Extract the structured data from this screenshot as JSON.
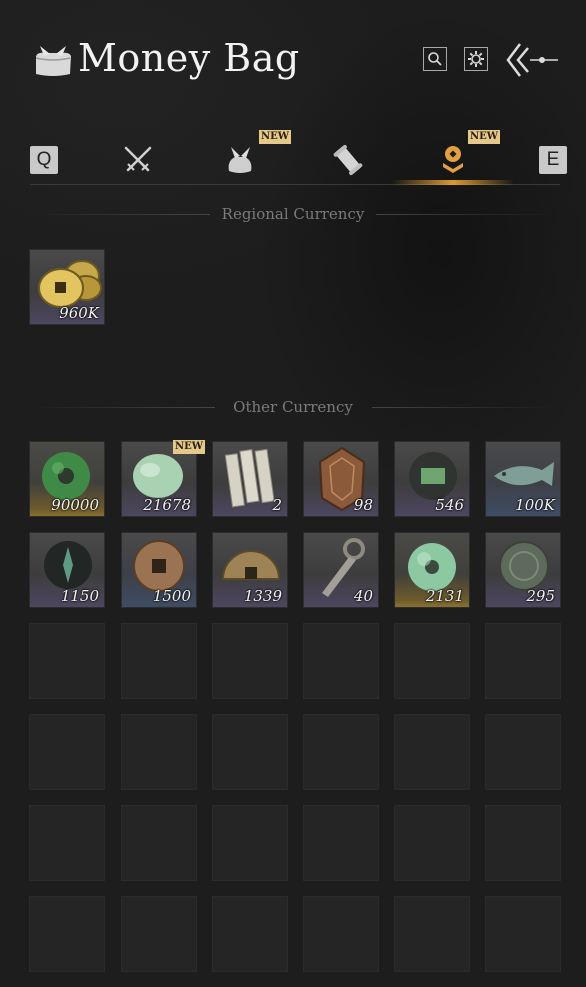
{
  "header": {
    "title": "Money Bag",
    "icons": [
      "money-bag-icon",
      "search-icon",
      "settings-icon",
      "back-arrow-icon"
    ]
  },
  "tabs": {
    "left_key": "Q",
    "right_key": "E",
    "items": [
      {
        "name": "crossed-swords-icon",
        "new": false
      },
      {
        "name": "bundle-icon",
        "new": true
      },
      {
        "name": "scroll-icon",
        "new": false
      },
      {
        "name": "coin-stack-icon",
        "new": true,
        "active": true
      }
    ],
    "new_label": "NEW",
    "accent_color": "#e0a040"
  },
  "regional": {
    "label": "Regional Currency",
    "items": [
      {
        "name": "gold-coins",
        "qty": "960K"
      }
    ]
  },
  "other": {
    "label": "Other Currency",
    "items": [
      {
        "name": "green-jade-ring",
        "qty": "90000"
      },
      {
        "name": "pale-jade-stone",
        "qty": "21678",
        "new": true
      },
      {
        "name": "paper-notes",
        "qty": "2"
      },
      {
        "name": "bronze-token",
        "qty": "98"
      },
      {
        "name": "green-map-token",
        "qty": "546"
      },
      {
        "name": "jade-fish",
        "qty": "100K"
      },
      {
        "name": "dark-sigil",
        "qty": "1150"
      },
      {
        "name": "bronze-coin",
        "qty": "1500"
      },
      {
        "name": "half-coin",
        "qty": "1339"
      },
      {
        "name": "knife-coin",
        "qty": "40"
      },
      {
        "name": "jade-disc",
        "qty": "2131"
      },
      {
        "name": "ancient-coin",
        "qty": "295"
      }
    ],
    "new_label": "NEW"
  }
}
